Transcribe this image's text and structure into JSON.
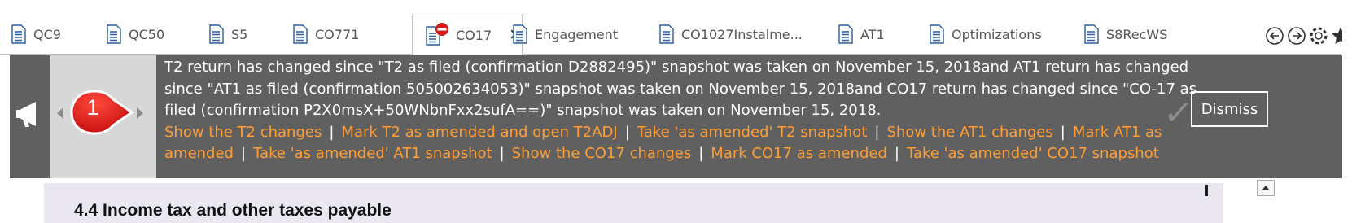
{
  "tabs": [
    {
      "label": "QC9",
      "active": false
    },
    {
      "label": "QC50",
      "active": false
    },
    {
      "label": "S5",
      "active": false
    },
    {
      "label": "CO771",
      "active": false
    },
    {
      "label": "CO17",
      "active": true,
      "status_icon": "no-entry-icon",
      "close_glyph": "✕"
    },
    {
      "label": "Engagement",
      "active": false
    },
    {
      "label": "CO1027Instalme...",
      "active": false
    },
    {
      "label": "AT1",
      "active": false
    },
    {
      "label": "Optimizations",
      "active": false
    },
    {
      "label": "S8RecWS",
      "active": false
    }
  ],
  "tab_nav_icons": [
    "circle-left-arrow-icon",
    "circle-right-arrow-icon",
    "refresh-circle-icon",
    "star-icon"
  ],
  "banner": {
    "step_number": "1",
    "message_lines": [
      "T2 return has changed since \"T2 as filed (confirmation D2882495)\" snapshot was taken on November 15, 2018and AT1 return has changed",
      "since \"AT1 as filed (confirmation 505002634053)\" snapshot was taken on November 15, 2018and CO17 return has changed since \"CO-17 as",
      "filed (confirmation P2X0msX+50WNbnFxx2sufA==)\" snapshot was taken on November 15, 2018."
    ],
    "actions": [
      "Show the T2 changes",
      "Mark T2 as amended and open T2ADJ",
      "Take 'as amended' T2 snapshot",
      "Show the AT1 changes",
      "Mark AT1 as",
      "amended",
      "Take 'as amended' AT1 snapshot",
      "Show the CO17 changes",
      "Mark CO17 as amended",
      "Take 'as amended' CO17 snapshot"
    ],
    "separator": "|",
    "dismiss_label": "Dismiss",
    "check_glyph": "✓"
  },
  "document": {
    "section_title": "4.4   Income tax and other taxes payable"
  },
  "colors": {
    "banner_bg": "#606060",
    "link": "#ff9e35",
    "callout_red": "#e01e1e",
    "doc_page_bg": "#ebe7f1"
  }
}
